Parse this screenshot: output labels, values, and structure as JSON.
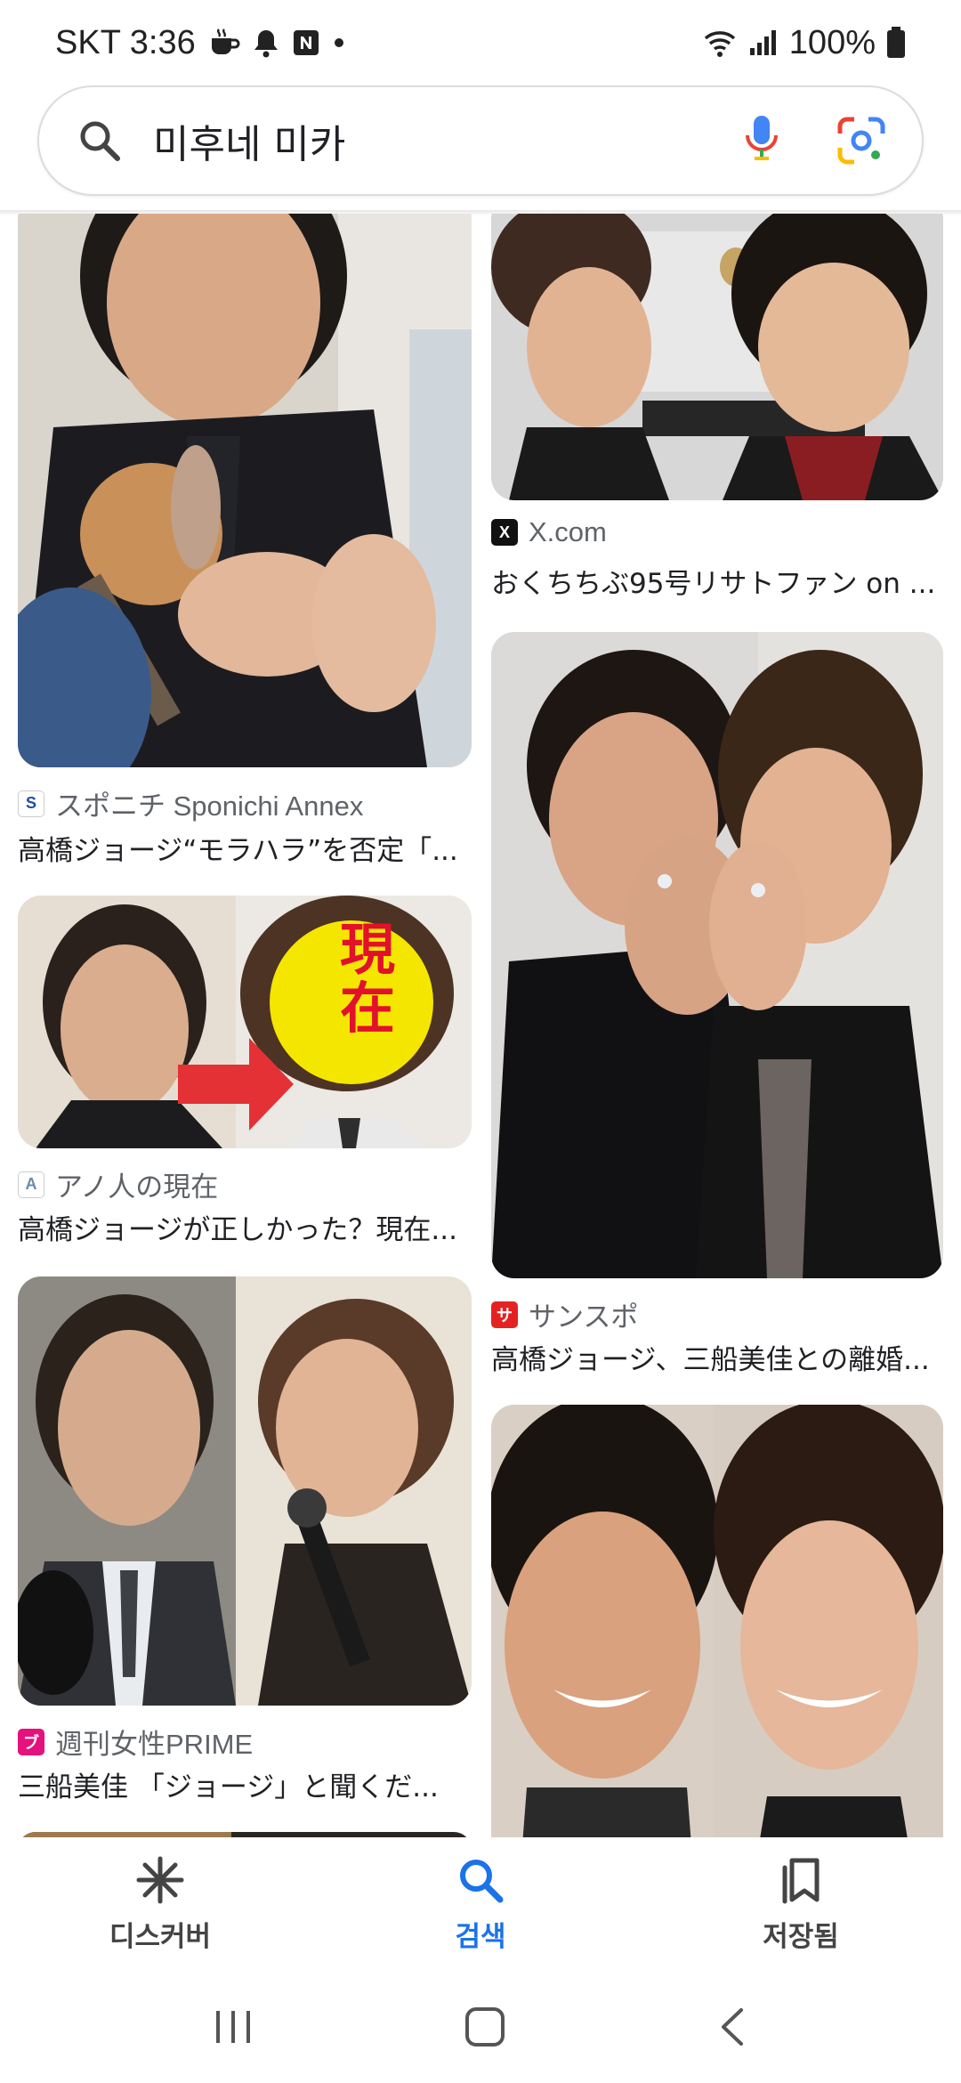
{
  "status_bar": {
    "carrier_time": "SKT 3:36",
    "battery": "100%"
  },
  "search": {
    "query": "미후네 미카"
  },
  "results_left": [
    {
      "source": "スポニチ Sponichi Annex",
      "title": "高橋ジョージ“モラハラ”を否定「..."
    },
    {
      "source": "アノ人の現在",
      "title": "高橋ジョージが正しかった？現在...",
      "overlay_text": "現在"
    },
    {
      "source": "週刊女性PRIME",
      "title": "三船美佳 「ジョージ」と聞くだ..."
    }
  ],
  "results_right": [
    {
      "source": "X.com",
      "title": "おくちちぶ95号リサトファン on ..."
    },
    {
      "source": "サンスポ",
      "title": "高橋ジョージ、三船美佳との離婚..."
    },
    {
      "source": "",
      "title": ""
    }
  ],
  "bottom_nav": {
    "discover": "디스커버",
    "search": "검색",
    "saved": "저장됨"
  },
  "colors": {
    "accent": "#1a73e8",
    "text": "#202124",
    "secondary": "#5f6368"
  }
}
